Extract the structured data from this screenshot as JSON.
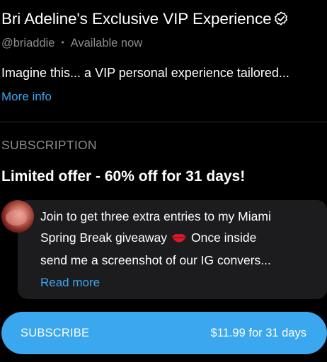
{
  "header": {
    "title": "Bri Adeline's Exclusive VIP Experience",
    "verified_icon": "verified-badge-icon",
    "handle": "@briaddie",
    "separator": "•",
    "status": "Available now"
  },
  "about": {
    "text": "Imagine this... a VIP personal experience tailored...",
    "more_label": "More info"
  },
  "subscription": {
    "section_label": "SUBSCRIPTION",
    "offer_title": "Limited offer - 60% off for 31 days!",
    "message": {
      "line1": "Join to get three extra entries to my Miami",
      "line2a": "Spring Break giveaway",
      "line2_icon": "kiss-lips-icon",
      "line2b": "Once inside",
      "line3": "send me a screenshot of our IG convers...",
      "read_more_label": "Read more"
    },
    "button": {
      "label": "SUBSCRIBE",
      "price": "$11.99 for 31 days"
    }
  },
  "colors": {
    "background": "#000000",
    "accent": "#3aa7ee",
    "muted_text": "#8a8d91",
    "bubble": "#1c1c1f"
  }
}
